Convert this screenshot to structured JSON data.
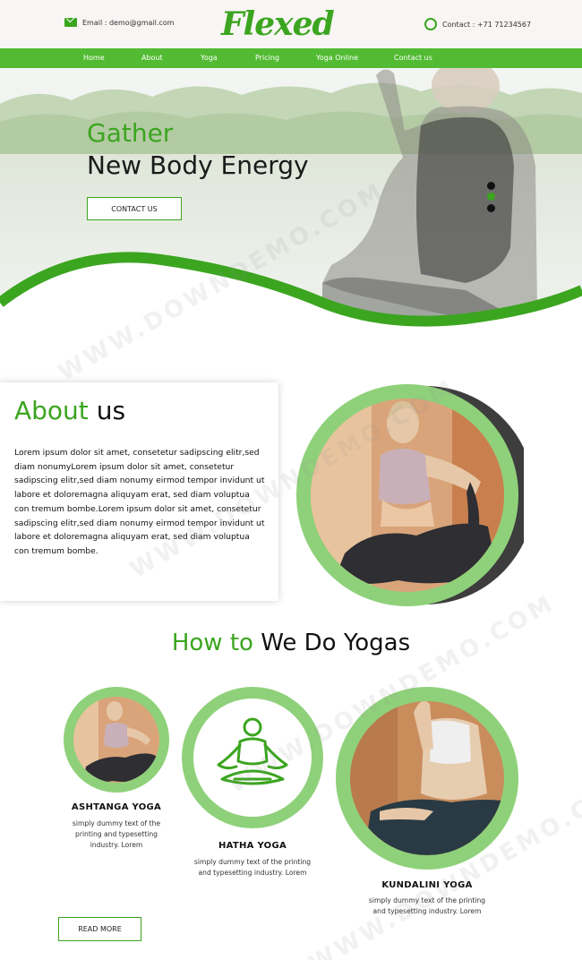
{
  "header": {
    "email_text": "Email : demo@gmail.com",
    "logo": "Flexed",
    "contact_text": "Contact : +71 71234567"
  },
  "nav": {
    "items": [
      "Home",
      "About",
      "Yoga",
      "Pricing",
      "Yoga Online",
      "Contact us"
    ]
  },
  "hero": {
    "title_line1": "Gather",
    "title_line2": "New Body Energy",
    "cta_label": "CONTACT US",
    "slider_dots": 3,
    "active_dot": 2
  },
  "about": {
    "title_green": "About",
    "title_dark": "us",
    "body": "Lorem ipsum dolor sit amet, consetetur sadipscing elitr,sed diam nonumyLorem ipsum dolor sit amet, consetetur sadipscing elitr,sed diam nonumy eirmod tempor invidunt ut labore et doloremagna aliquyam erat, sed diam voluptua con tremum bombe.Lorem ipsum dolor sit amet, consetetur sadipscing elitr,sed diam nonumy eirmod tempor invidunt ut labore et doloremagna aliquyam erat, sed diam voluptua con tremum bombe."
  },
  "how": {
    "title_green": "How to",
    "title_dark": "We Do Yogas",
    "cards": [
      {
        "title": "ASHTANGA YOGA",
        "text": "simply dummy text of the printing and typesetting industry. Lorem"
      },
      {
        "title": "HATHA YOGA",
        "text": "simply dummy text of the printing and typesetting industry. Lorem"
      },
      {
        "title": "KUNDALINI YOGA",
        "text": "simply dummy text of the printing and typesetting industry. Lorem"
      }
    ],
    "read_more": "READ MORE"
  },
  "watermark": "WWW.DOWNDEMO.COM",
  "colors": {
    "accent": "#3ba51f",
    "nav": "#52bb33",
    "ring": "#8fd17a"
  },
  "icons": [
    "email-icon",
    "phone-icon",
    "meditation-icon"
  ]
}
